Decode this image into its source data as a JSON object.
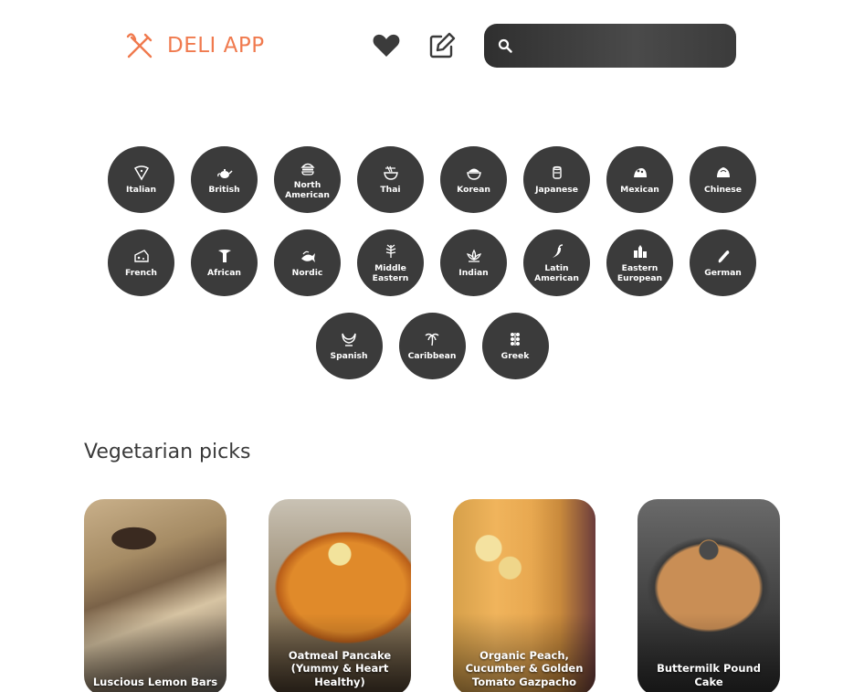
{
  "header": {
    "app_name": "DELI APP",
    "search_placeholder": "",
    "icons": [
      "fork-knife-icon",
      "heart-icon",
      "edit-icon",
      "search-icon"
    ],
    "colors": {
      "brand": "#f07a4e",
      "dark": "#3b3b3b"
    }
  },
  "cuisines": [
    {
      "label": "Italian",
      "icon": "pizza-icon"
    },
    {
      "label": "British",
      "icon": "teapot-icon"
    },
    {
      "label": "North American",
      "icon": "burger-icon"
    },
    {
      "label": "Thai",
      "icon": "noodle-bowl-icon"
    },
    {
      "label": "Korean",
      "icon": "rice-bowl-icon"
    },
    {
      "label": "Japanese",
      "icon": "sake-cup-icon"
    },
    {
      "label": "Mexican",
      "icon": "taco-icon"
    },
    {
      "label": "Chinese",
      "icon": "dumpling-icon"
    },
    {
      "label": "French",
      "icon": "cheese-icon"
    },
    {
      "label": "African",
      "icon": "baobab-tree-icon"
    },
    {
      "label": "Nordic",
      "icon": "fish-icon"
    },
    {
      "label": "Middle Eastern",
      "icon": "wheat-icon"
    },
    {
      "label": "Indian",
      "icon": "lotus-icon"
    },
    {
      "label": "Latin American",
      "icon": "chili-icon"
    },
    {
      "label": "Eastern European",
      "icon": "city-icon"
    },
    {
      "label": "German",
      "icon": "sausage-icon"
    },
    {
      "label": "Spanish",
      "icon": "bull-horns-icon"
    },
    {
      "label": "Caribbean",
      "icon": "palm-tree-icon"
    },
    {
      "label": "Greek",
      "icon": "grapes-icon"
    }
  ],
  "section": {
    "title": "Vegetarian picks",
    "cards": [
      {
        "title": "Luscious Lemon Bars"
      },
      {
        "title": "Oatmeal Pancake (Yummy & Heart Healthy)"
      },
      {
        "title": "Organic Peach, Cucumber & Golden Tomato Gazpacho"
      },
      {
        "title": "Buttermilk Pound Cake"
      }
    ]
  }
}
